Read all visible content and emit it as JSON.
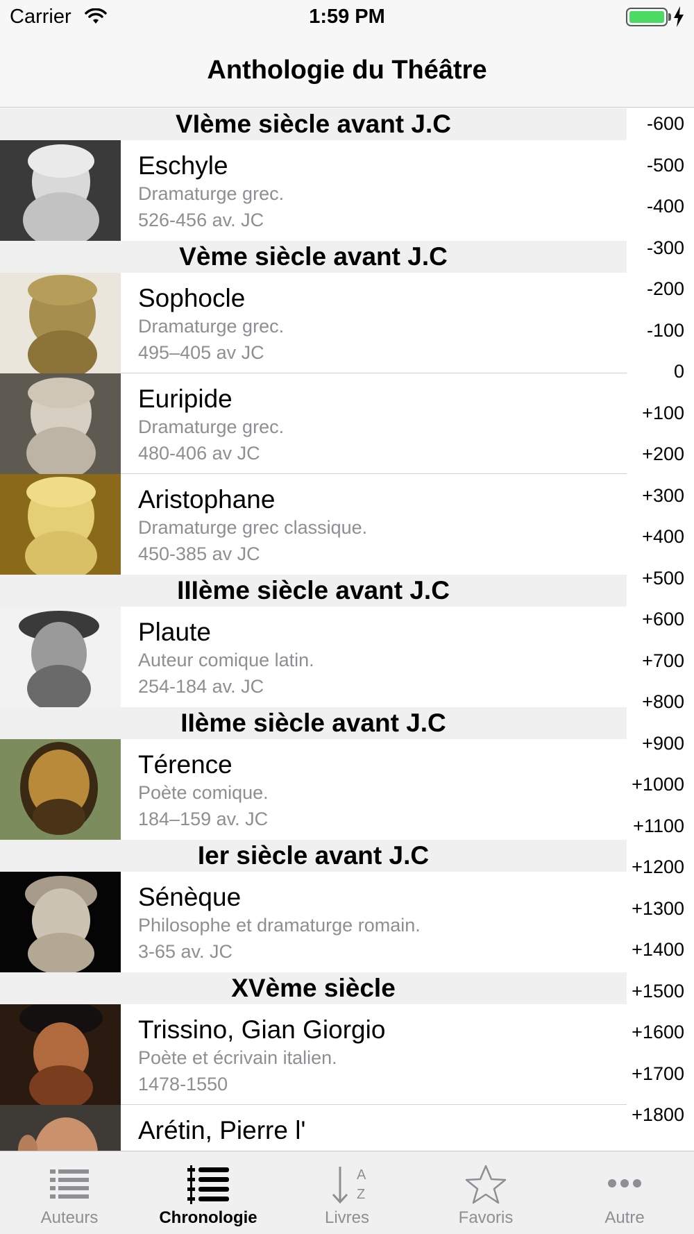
{
  "status_bar": {
    "carrier": "Carrier",
    "time": "1:59 PM"
  },
  "nav": {
    "title": "Anthologie du Théâtre"
  },
  "sections": [
    {
      "header": "VIème siècle avant J.C",
      "items": [
        {
          "name": "Eschyle",
          "description": "Dramaturge grec.",
          "dates": "526-456 av. JC"
        }
      ]
    },
    {
      "header": "Vème siècle avant J.C",
      "items": [
        {
          "name": "Sophocle",
          "description": "Dramaturge grec.",
          "dates": "495–405 av JC"
        },
        {
          "name": "Euripide",
          "description": "Dramaturge grec.",
          "dates": "480-406 av JC"
        },
        {
          "name": "Aristophane",
          "description": "Dramaturge grec classique.",
          "dates": "450-385 av JC"
        }
      ]
    },
    {
      "header": "IIIème siècle avant J.C",
      "items": [
        {
          "name": "Plaute",
          "description": "Auteur comique latin.",
          "dates": "254-184 av. JC"
        }
      ]
    },
    {
      "header": "IIème siècle avant J.C",
      "items": [
        {
          "name": "Térence",
          "description": "Poète comique.",
          "dates": "184–159 av. JC"
        }
      ]
    },
    {
      "header": "Ier siècle avant J.C",
      "items": [
        {
          "name": "Sénèque",
          "description": "Philosophe et dramaturge romain.",
          "dates": "3-65 av. JC"
        }
      ]
    },
    {
      "header": "XVème siècle",
      "items": [
        {
          "name": "Trissino, Gian Giorgio",
          "description": "Poète et écrivain italien.",
          "dates": "1478-1550"
        },
        {
          "name": "Arétin, Pierre l'",
          "description": "",
          "dates": ""
        }
      ]
    }
  ],
  "index": [
    "-600",
    "-500",
    "-400",
    "-300",
    "-200",
    "-100",
    "0",
    "+100",
    "+200",
    "+300",
    "+400",
    "+500",
    "+600",
    "+700",
    "+800",
    "+900",
    "+1000",
    "+1100",
    "+1200",
    "+1300",
    "+1400",
    "+1500",
    "+1600",
    "+1700",
    "+1800"
  ],
  "tabs": [
    {
      "label": "Auteurs",
      "icon": "list-icon"
    },
    {
      "label": "Chronologie",
      "icon": "timeline-icon"
    },
    {
      "label": "Livres",
      "icon": "sort-az-icon"
    },
    {
      "label": "Favoris",
      "icon": "star-icon"
    },
    {
      "label": "Autre",
      "icon": "more-icon"
    }
  ],
  "active_tab": "Chronologie",
  "colors": {
    "accent": "#000000",
    "inactive": "#8e8e93",
    "section_bg": "#f0f0f0",
    "battery": "#4cd964"
  }
}
